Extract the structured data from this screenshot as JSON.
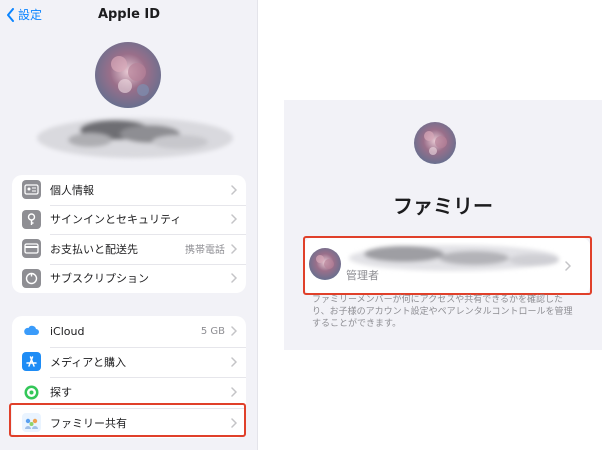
{
  "left": {
    "back_label": "設定",
    "title": "Apple ID",
    "group1": [
      {
        "label": "個人情報",
        "icon": "id-card-icon",
        "value": ""
      },
      {
        "label": "サインインとセキュリティ",
        "icon": "key-icon",
        "value": ""
      },
      {
        "label": "お支払いと配送先",
        "icon": "credit-card-icon",
        "value": "携帯電話"
      },
      {
        "label": "サブスクリプション",
        "icon": "subscription-icon",
        "value": ""
      }
    ],
    "group2": [
      {
        "label": "iCloud",
        "icon": "icloud-icon",
        "value": "5 GB"
      },
      {
        "label": "メディアと購入",
        "icon": "app-store-icon",
        "value": ""
      },
      {
        "label": "探す",
        "icon": "find-my-icon",
        "value": ""
      },
      {
        "label": "ファミリー共有",
        "icon": "family-sharing-icon",
        "value": ""
      }
    ]
  },
  "right": {
    "title": "ファミリー",
    "member_role": "管理者",
    "description": "ファミリーメンバーが何にアクセスや共有できるかを確認したり、お子様のアカウント設定やペアレンタルコントロールを管理することができます。"
  },
  "colors": {
    "accent": "#0a84ff",
    "highlight": "#e0402a",
    "background": "#f2f2f7"
  }
}
